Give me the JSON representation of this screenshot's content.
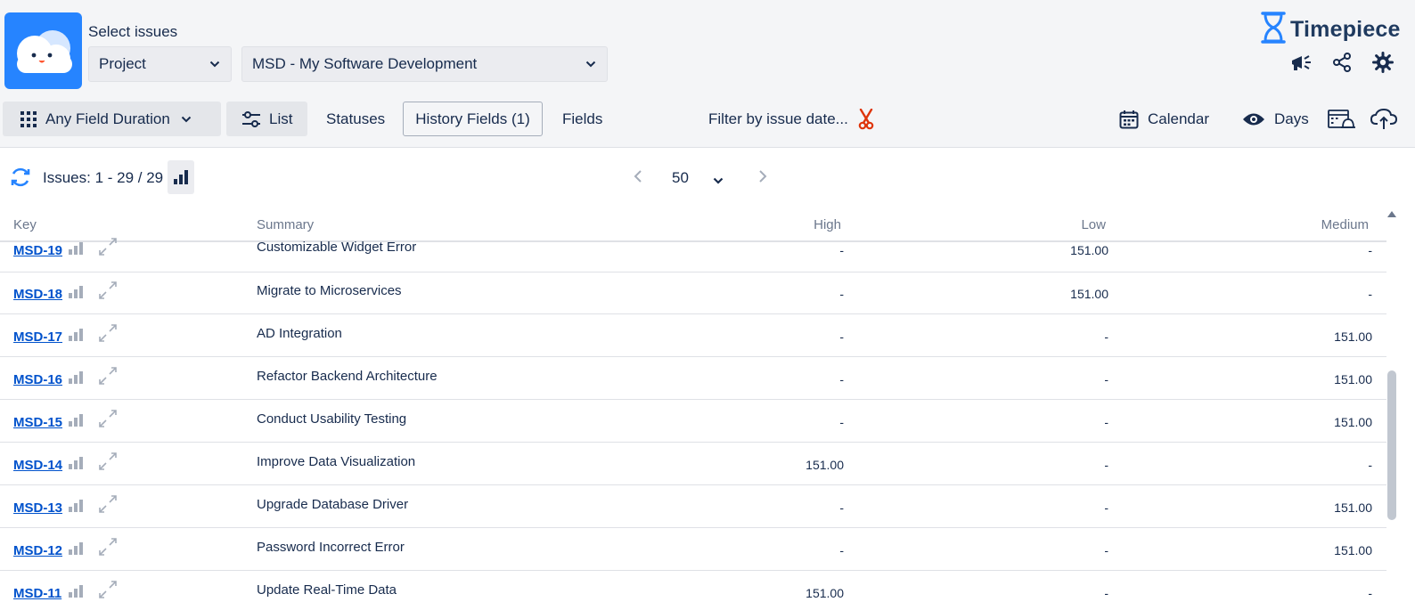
{
  "header": {
    "select_title": "Select issues",
    "scope_dropdown": "Project",
    "project_dropdown": "MSD - My Software Development",
    "brand": "Timepiece",
    "icons": [
      "megaphone-icon",
      "share-icon",
      "gear-icon"
    ]
  },
  "toolbar": {
    "report_type": "Any Field Duration",
    "list": "List",
    "statuses": "Statuses",
    "history_fields": "History Fields (1)",
    "fields": "Fields",
    "filter": "Filter by issue date...",
    "calendar": "Calendar",
    "days": "Days"
  },
  "issues_bar": {
    "count": "Issues: 1 - 29 / 29",
    "page_size": "50"
  },
  "table": {
    "columns": [
      "Key",
      "Summary",
      "High",
      "Low",
      "Medium"
    ],
    "rows": [
      {
        "key": "MSD-19",
        "summary": "Customizable Widget Error",
        "high": "-",
        "low": "151.00",
        "medium": "-"
      },
      {
        "key": "MSD-18",
        "summary": "Migrate to Microservices",
        "high": "-",
        "low": "151.00",
        "medium": "-"
      },
      {
        "key": "MSD-17",
        "summary": "AD Integration",
        "high": "-",
        "low": "-",
        "medium": "151.00"
      },
      {
        "key": "MSD-16",
        "summary": "Refactor Backend Architecture",
        "high": "-",
        "low": "-",
        "medium": "151.00"
      },
      {
        "key": "MSD-15",
        "summary": "Conduct Usability Testing",
        "high": "-",
        "low": "-",
        "medium": "151.00"
      },
      {
        "key": "MSD-14",
        "summary": "Improve Data Visualization",
        "high": "151.00",
        "low": "-",
        "medium": "-"
      },
      {
        "key": "MSD-13",
        "summary": "Upgrade Database Driver",
        "high": "-",
        "low": "-",
        "medium": "151.00"
      },
      {
        "key": "MSD-12",
        "summary": "Password Incorrect Error",
        "high": "-",
        "low": "-",
        "medium": "151.00"
      },
      {
        "key": "MSD-11",
        "summary": "Update Real-Time Data",
        "high": "151.00",
        "low": "-",
        "medium": "-"
      }
    ]
  },
  "colors": {
    "link": "#0052cc",
    "logo_bg": "#2684ff",
    "filter_clear": "#de350b"
  }
}
